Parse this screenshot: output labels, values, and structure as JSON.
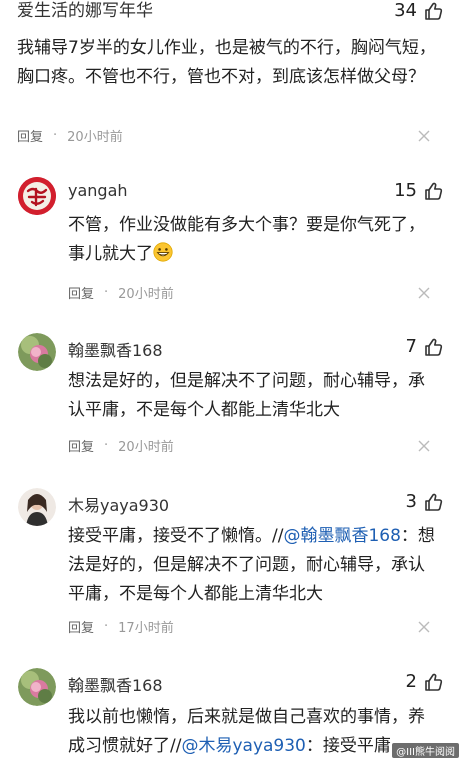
{
  "top_comment": {
    "author": "爱生活的娜写年华",
    "likes": "34",
    "text": "我辅导7岁半的女儿作业，也是被气的不行，胸闷气短，胸口疼。不管也不行，管也不对，到底该怎样做父母？",
    "reply_label": "回复",
    "time": "20小时前"
  },
  "replies": [
    {
      "author": "yangah",
      "likes": "15",
      "text": "不管，作业没做能有多大个事？要是你气死了，事儿就大了",
      "emoji": "grinning-face-icon",
      "reply_label": "回复",
      "time": "20小时前"
    },
    {
      "author": "翰墨飘香168",
      "likes": "7",
      "text": "想法是好的，但是解决不了问题，耐心辅导，承认平庸，不是每个人都能上清华北大",
      "reply_label": "回复",
      "time": "20小时前"
    },
    {
      "author": "木易yaya930",
      "likes": "3",
      "text_before": "接受平庸，接受不了懒惰。//",
      "mention": "@翰墨飘香168",
      "text_after": "：想法是好的，但是解决不了问题，耐心辅导，承认平庸，不是每个人都能上清华北大",
      "reply_label": "回复",
      "time": "17小时前"
    },
    {
      "author": "翰墨飘香168",
      "likes": "2",
      "text_before": "我以前也懒惰，后来就是做自己喜欢的事情，养成习惯就好了//",
      "mention": "@木易yaya930",
      "text_after": "：接受平庸",
      "watermark": "@III熊牛阅阅"
    }
  ],
  "colors": {
    "mention": "#1e5fb3",
    "meta": "#999999"
  }
}
